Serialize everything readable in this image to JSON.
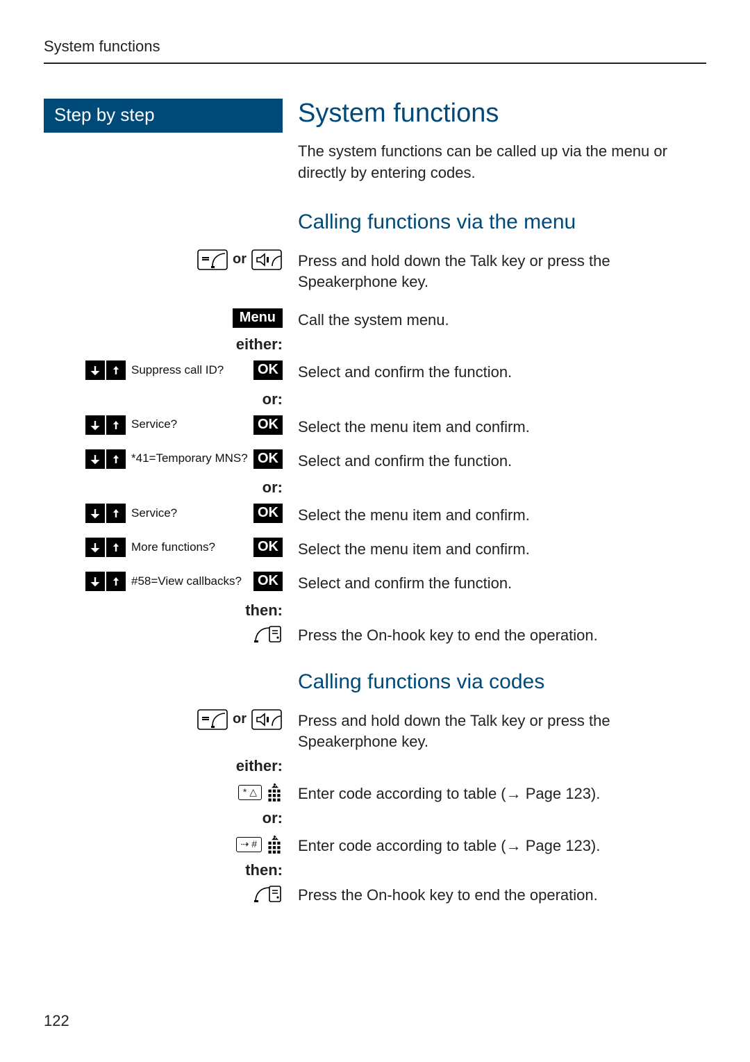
{
  "running_head": "System functions",
  "step_header": "Step by step",
  "h1": "System functions",
  "intro": "The system functions can be called up via the menu or directly by entering codes.",
  "h2_menu": "Calling functions via the menu",
  "h2_codes": "Calling functions via codes",
  "labels": {
    "or": "or",
    "or_colon": "or:",
    "either": "either:",
    "then": "then:",
    "menu": "Menu",
    "ok": "OK"
  },
  "steps_menu": {
    "talk": "Press and hold down the Talk key or press the Speakerphone key.",
    "call_menu": "Call the system menu.",
    "suppress": {
      "caption": "Suppress call ID?",
      "desc": "Select and confirm the function."
    },
    "service1": {
      "caption": "Service?",
      "desc": "Select the menu item and confirm."
    },
    "temp_mns": {
      "caption": "*41=Temporary MNS?",
      "desc": "Select and confirm the function."
    },
    "service2": {
      "caption": "Service?",
      "desc": "Select the menu item and confirm."
    },
    "more_func": {
      "caption": "More functions?",
      "desc": "Select the menu item and confirm."
    },
    "view_cb": {
      "caption": "#58=View callbacks?",
      "desc": "Select and confirm the function."
    },
    "onhook": "Press the On-hook key to end the operation."
  },
  "steps_codes": {
    "talk": "Press and hold down the Talk key or press the Speakerphone key.",
    "star_code": "Enter code according to table (→ Page 123).",
    "hash_code": "Enter code according to table (→ Page 123).",
    "onhook": "Press the On-hook key to end the operation.",
    "star_key": "* △",
    "hash_key": "⇢ #"
  },
  "page_number": "122"
}
